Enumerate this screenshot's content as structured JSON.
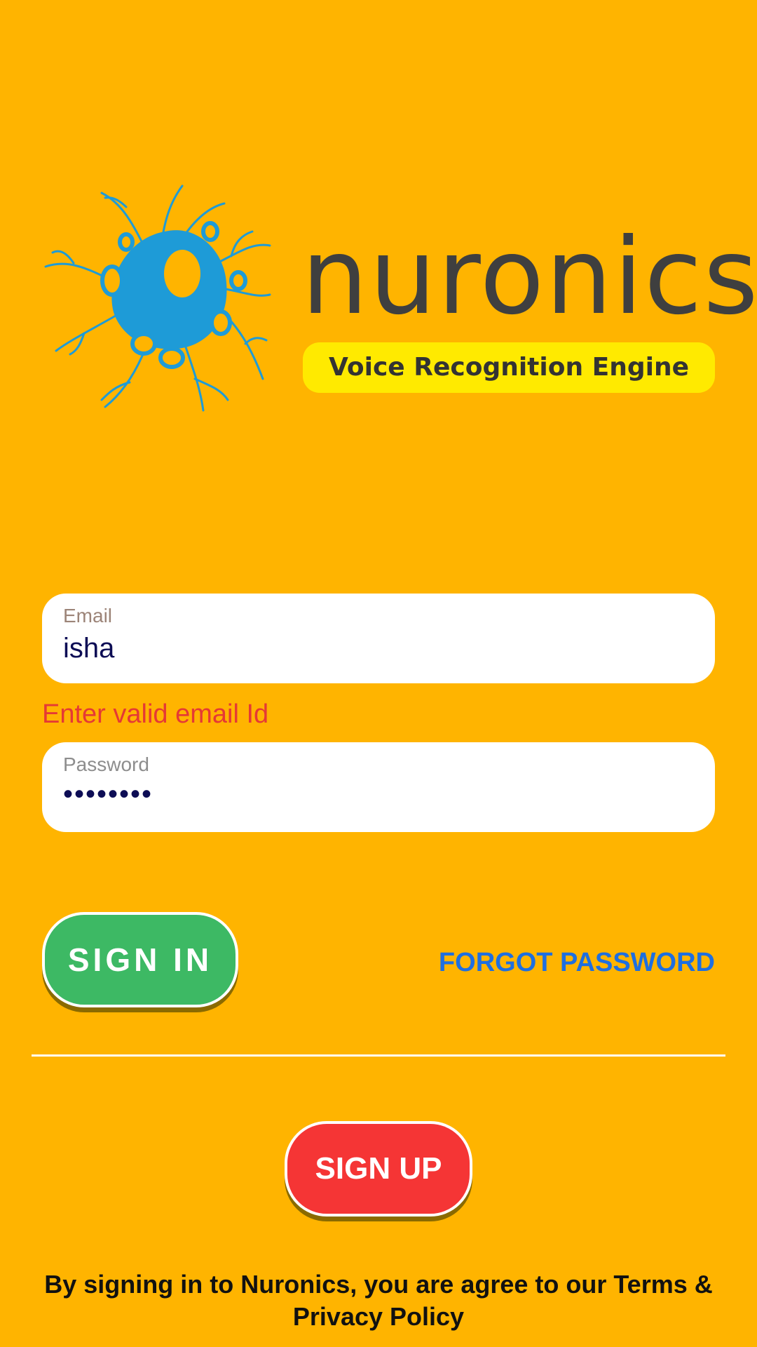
{
  "brand": {
    "name": "nuronics",
    "tagline": "Voice Recognition Engine",
    "logo_icon": "neuron-logo-icon"
  },
  "form": {
    "email_label": "Email",
    "email_value": "isha",
    "email_error": "Enter valid email Id",
    "password_label": "Password",
    "password_value_masked": "••••••••"
  },
  "actions": {
    "sign_in_label": "SIGN IN",
    "forgot_password_label": "FORGOT PASSWORD",
    "sign_up_label": "SIGN UP"
  },
  "footer": {
    "legal_text": "By signing in to Nuronics, you are agree to our Terms & Privacy Policy"
  },
  "colors": {
    "background": "#FFB400",
    "sign_in": "#3DB964",
    "sign_up": "#F53535",
    "link": "#1E6FE0",
    "error": "#E53935",
    "logo_blue": "#1E9BD7",
    "tagline_bg": "#FFEA00"
  }
}
